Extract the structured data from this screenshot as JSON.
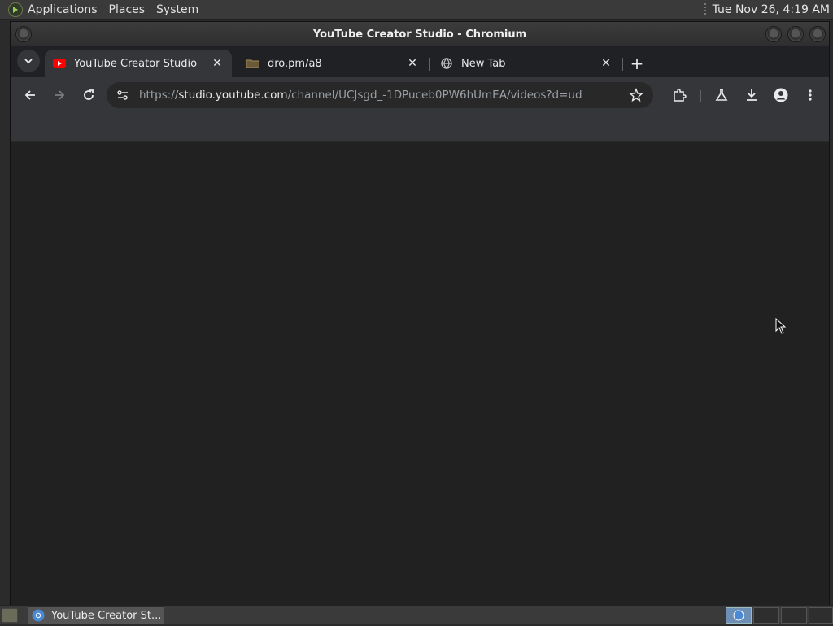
{
  "top_panel": {
    "menus": [
      "Applications",
      "Places",
      "System"
    ],
    "clock": "Tue Nov 26,  4:19 AM"
  },
  "window": {
    "title": "YouTube Creator Studio - Chromium"
  },
  "tabs": [
    {
      "label": "YouTube Creator Studio",
      "active": true,
      "favicon": "youtube-icon"
    },
    {
      "label": "dro.pm/a8",
      "active": false,
      "favicon": "folder-icon"
    },
    {
      "label": "New Tab",
      "active": false,
      "favicon": "globe-icon"
    }
  ],
  "toolbar": {
    "url_scheme": "https://",
    "url_host": "studio.youtube.com",
    "url_path": "/channel/UCJsgd_-1DPuceb0PW6hUmEA/videos?d=ud"
  },
  "taskbar": {
    "task_label": "YouTube Creator St..."
  },
  "colors": {
    "youtube_red": "#ff0000",
    "chrome_tab_active": "#35363a",
    "chrome_bg": "#202124"
  }
}
